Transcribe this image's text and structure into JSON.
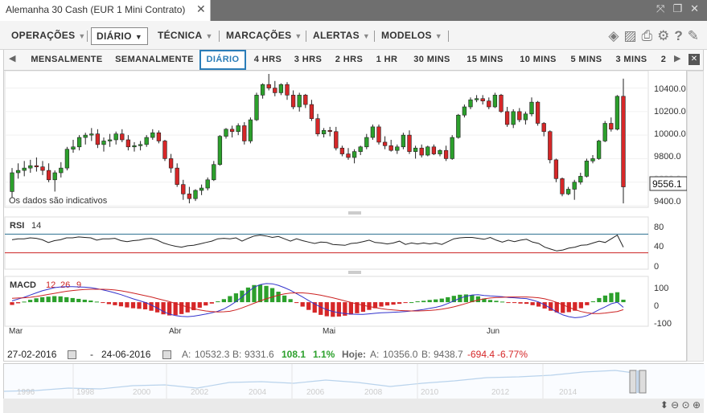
{
  "window": {
    "tab_title": "Alemanha 30 Cash (EUR 1 Mini Contrato)",
    "close_glyph": "✕",
    "icons": [
      "fit-icon",
      "restore-icon",
      "close-icon"
    ]
  },
  "menu": {
    "items": [
      {
        "label": "OPERAÇÕES",
        "active": false
      },
      {
        "label": "DIÁRIO",
        "active": true
      },
      {
        "label": "TÉCNICA",
        "active": false
      },
      {
        "label": "MARCAÇÕES",
        "active": false
      },
      {
        "label": "ALERTAS",
        "active": false
      },
      {
        "label": "MODELOS",
        "active": false
      }
    ],
    "tool_icons": [
      "layers-icon",
      "image-icon",
      "print-icon",
      "gear-icon",
      "help-icon",
      "pin-icon"
    ]
  },
  "timeframes": {
    "items": [
      "MENSALMENTE",
      "SEMANALMENTE",
      "DIÁRIO",
      "4 HRS",
      "3 HRS",
      "2 HRS",
      "1 HR",
      "30 MINS",
      "15 MINS",
      "10 MINS",
      "5 MINS",
      "3 MINS",
      "2"
    ],
    "active": "DIÁRIO"
  },
  "price_panel": {
    "note": "Os dados são indicativos",
    "y_ticks": [
      "10400.0",
      "10200.0",
      "10000.0",
      "9800.0",
      "9600.0",
      "9400.0"
    ],
    "current_price": "9556.1"
  },
  "rsi_panel": {
    "label": "RSI",
    "period": "14",
    "y_ticks": [
      "80",
      "40",
      "0"
    ]
  },
  "macd_panel": {
    "label": "MACD",
    "params": [
      "12",
      "26",
      "9"
    ],
    "y_ticks": [
      "100",
      "0",
      "-100"
    ]
  },
  "x_axis": {
    "months": [
      "Mar",
      "Abr",
      "Mai",
      "Jun"
    ]
  },
  "info": {
    "date_from": "27-02-2016",
    "dash": "-",
    "date_to": "24-06-2016",
    "a_label": "A:",
    "a_value": "10532.3",
    "b_label": "B:",
    "b_value": "9331.6",
    "change": "108.1",
    "change_pct": "1.1%",
    "today_label": "Hoje:",
    "today_a_label": "A:",
    "today_a": "10356.0",
    "today_b_label": "B:",
    "today_b": "9438.7",
    "today_change": "-694.4",
    "today_change_pct": "-6.77%"
  },
  "navigator": {
    "years": [
      "1996",
      "1998",
      "2000",
      "2002",
      "2004",
      "2006",
      "2008",
      "2010",
      "2012",
      "2014"
    ]
  },
  "colors": {
    "up": "#2ca02c",
    "down": "#d62728",
    "rsi_line": "#222222",
    "macd_line": "#3333cc",
    "signal_line": "#cc2222",
    "rsi_upper": "#2a6f8f",
    "rsi_lower": "#cc2222",
    "accent": "#2a7db8"
  },
  "chart_data": [
    {
      "type": "candlestick",
      "title": "",
      "ylim": [
        9400,
        10520
      ],
      "current": 9556.1,
      "candles": [
        [
          9520,
          9720,
          9470,
          9680
        ],
        [
          9680,
          9760,
          9630,
          9700
        ],
        [
          9700,
          9780,
          9650,
          9720
        ],
        [
          9720,
          9790,
          9680,
          9740
        ],
        [
          9740,
          9810,
          9690,
          9730
        ],
        [
          9730,
          9780,
          9660,
          9700
        ],
        [
          9700,
          9760,
          9600,
          9620
        ],
        [
          9620,
          9700,
          9520,
          9680
        ],
        [
          9680,
          9770,
          9640,
          9720
        ],
        [
          9720,
          9900,
          9700,
          9880
        ],
        [
          9880,
          9960,
          9850,
          9900
        ],
        [
          9900,
          10000,
          9870,
          9980
        ],
        [
          9980,
          10020,
          9920,
          10000
        ],
        [
          10000,
          10060,
          9950,
          10010
        ],
        [
          10010,
          10050,
          9890,
          9920
        ],
        [
          9920,
          9980,
          9860,
          9950
        ],
        [
          9950,
          10010,
          9900,
          9960
        ],
        [
          9960,
          10030,
          9920,
          10010
        ],
        [
          10010,
          10050,
          9940,
          9960
        ],
        [
          9960,
          10000,
          9870,
          9900
        ],
        [
          9900,
          9940,
          9860,
          9910
        ],
        [
          9910,
          9950,
          9870,
          9920
        ],
        [
          9920,
          10000,
          9900,
          9980
        ],
        [
          9980,
          10050,
          9960,
          10020
        ],
        [
          10020,
          10040,
          9930,
          9950
        ],
        [
          9950,
          9960,
          9780,
          9800
        ],
        [
          9800,
          9840,
          9680,
          9720
        ],
        [
          9720,
          9760,
          9560,
          9580
        ],
        [
          9580,
          9620,
          9450,
          9500
        ],
        [
          9500,
          9560,
          9420,
          9460
        ],
        [
          9460,
          9540,
          9440,
          9530
        ],
        [
          9530,
          9580,
          9490,
          9550
        ],
        [
          9550,
          9640,
          9530,
          9620
        ],
        [
          9620,
          9780,
          9610,
          9750
        ],
        [
          9750,
          10000,
          9740,
          9990
        ],
        [
          9990,
          10060,
          9970,
          10050
        ],
        [
          10050,
          10080,
          9980,
          10030
        ],
        [
          10030,
          10100,
          10000,
          10080
        ],
        [
          10080,
          10110,
          9920,
          9950
        ],
        [
          9950,
          10150,
          9930,
          10130
        ],
        [
          10130,
          10360,
          10120,
          10340
        ],
        [
          10340,
          10440,
          10310,
          10430
        ],
        [
          10430,
          10520,
          10380,
          10400
        ],
        [
          10400,
          10460,
          10330,
          10360
        ],
        [
          10360,
          10440,
          10340,
          10430
        ],
        [
          10430,
          10450,
          10300,
          10340
        ],
        [
          10340,
          10380,
          10220,
          10240
        ],
        [
          10240,
          10360,
          10200,
          10340
        ],
        [
          10340,
          10350,
          10230,
          10260
        ],
        [
          10260,
          10300,
          10120,
          10140
        ],
        [
          10140,
          10180,
          9990,
          10010
        ],
        [
          10010,
          10060,
          9980,
          10040
        ],
        [
          10040,
          10070,
          9990,
          10030
        ],
        [
          10030,
          10070,
          9870,
          9890
        ],
        [
          9890,
          9910,
          9820,
          9840
        ],
        [
          9840,
          9890,
          9790,
          9810
        ],
        [
          9810,
          9880,
          9760,
          9860
        ],
        [
          9860,
          9910,
          9830,
          9900
        ],
        [
          9900,
          10010,
          9880,
          9980
        ],
        [
          9980,
          10090,
          9960,
          10070
        ],
        [
          10070,
          10090,
          9920,
          9940
        ],
        [
          9940,
          9990,
          9880,
          9910
        ],
        [
          9910,
          9960,
          9860,
          9870
        ],
        [
          9870,
          9920,
          9840,
          9900
        ],
        [
          9900,
          10020,
          9880,
          10000
        ],
        [
          10000,
          10040,
          9840,
          9860
        ],
        [
          9860,
          9910,
          9800,
          9890
        ],
        [
          9890,
          9920,
          9810,
          9830
        ],
        [
          9830,
          9910,
          9820,
          9900
        ],
        [
          9900,
          9920,
          9830,
          9840
        ],
        [
          9840,
          9880,
          9820,
          9870
        ],
        [
          9870,
          9910,
          9780,
          9800
        ],
        [
          9800,
          10000,
          9790,
          9980
        ],
        [
          9980,
          10180,
          9970,
          10170
        ],
        [
          10170,
          10260,
          10150,
          10240
        ],
        [
          10240,
          10320,
          10220,
          10300
        ],
        [
          10300,
          10340,
          10280,
          10310
        ],
        [
          10310,
          10340,
          10260,
          10290
        ],
        [
          10290,
          10320,
          10220,
          10240
        ],
        [
          10240,
          10360,
          10230,
          10340
        ],
        [
          10340,
          10350,
          10190,
          10200
        ],
        [
          10200,
          10240,
          10070,
          10090
        ],
        [
          10090,
          10220,
          10060,
          10200
        ],
        [
          10200,
          10230,
          10110,
          10130
        ],
        [
          10130,
          10200,
          10090,
          10180
        ],
        [
          10180,
          10320,
          10160,
          10280
        ],
        [
          10280,
          10290,
          10080,
          10100
        ],
        [
          10100,
          10110,
          9990,
          10030
        ],
        [
          10030,
          10040,
          9760,
          9790
        ],
        [
          9790,
          9800,
          9600,
          9630
        ],
        [
          9630,
          9640,
          9480,
          9500
        ],
        [
          9500,
          9560,
          9490,
          9540
        ],
        [
          9540,
          9620,
          9450,
          9600
        ],
        [
          9600,
          9680,
          9580,
          9650
        ],
        [
          9650,
          9800,
          9640,
          9780
        ],
        [
          9780,
          9830,
          9760,
          9800
        ],
        [
          9800,
          9960,
          9790,
          9950
        ],
        [
          9950,
          10120,
          9940,
          10100
        ],
        [
          10100,
          10150,
          10030,
          10050
        ],
        [
          10050,
          10340,
          10040,
          10330
        ],
        [
          10330,
          10480,
          9420,
          9560
        ]
      ]
    },
    {
      "type": "line",
      "title": "",
      "ylim": [
        0,
        100
      ],
      "series": [
        {
          "name": "RSI 14",
          "values": [
            58,
            60,
            60,
            62,
            61,
            58,
            52,
            56,
            58,
            62,
            62,
            64,
            63,
            62,
            57,
            60,
            60,
            61,
            56,
            54,
            56,
            57,
            60,
            61,
            57,
            51,
            47,
            44,
            42,
            45,
            46,
            49,
            52,
            55,
            60,
            61,
            60,
            62,
            55,
            61,
            66,
            68,
            66,
            63,
            65,
            60,
            55,
            60,
            56,
            53,
            50,
            53,
            52,
            48,
            47,
            46,
            50,
            51,
            54,
            57,
            52,
            51,
            49,
            51,
            55,
            48,
            51,
            49,
            51,
            49,
            51,
            48,
            54,
            60,
            62,
            63,
            63,
            61,
            59,
            63,
            57,
            53,
            57,
            54,
            57,
            59,
            53,
            50,
            42,
            38,
            34,
            36,
            40,
            42,
            46,
            47,
            51,
            55,
            52,
            60,
            68,
            42
          ]
        }
      ],
      "reference_levels": [
        70,
        30
      ]
    },
    {
      "type": "bar",
      "title": "",
      "ylim": [
        -130,
        140
      ],
      "series": [
        {
          "name": "MACD",
          "values": [
            10,
            24,
            38,
            55,
            72,
            88,
            100,
            112,
            118,
            120,
            120,
            118,
            116,
            112,
            104,
            95,
            84,
            72,
            58,
            42,
            26,
            12,
            -2,
            -22,
            -46,
            -72,
            -92,
            -104,
            -110,
            -112,
            -108,
            -100,
            -92,
            -82,
            -70,
            -52,
            -26,
            4,
            40,
            80,
            116,
            136,
            144,
            142,
            130,
            112,
            92,
            66,
            40,
            12,
            -14,
            -38,
            -58,
            -72,
            -82,
            -88,
            -92,
            -94,
            -94,
            -90,
            -86,
            -82,
            -80,
            -78,
            -76,
            -72,
            -68,
            -62,
            -56,
            -48,
            -40,
            -28,
            -10,
            10,
            30,
            46,
            56,
            58,
            52,
            48,
            46,
            42,
            36,
            34,
            30,
            28,
            16,
            2,
            -20,
            -48,
            -76,
            -98,
            -112,
            -120,
            -116,
            -104,
            -82,
            -58,
            -36,
            -12,
            0,
            -40
          ]
        },
        {
          "name": "Signal",
          "values": [
            30,
            32,
            34,
            38,
            44,
            52,
            60,
            68,
            76,
            84,
            90,
            94,
            98,
            100,
            100,
            100,
            98,
            94,
            88,
            80,
            70,
            60,
            50,
            40,
            28,
            16,
            4,
            -10,
            -24,
            -38,
            -50,
            -60,
            -68,
            -72,
            -76,
            -74,
            -70,
            -60,
            -44,
            -26,
            -8,
            10,
            26,
            40,
            54,
            64,
            70,
            72,
            72,
            68,
            62,
            54,
            44,
            34,
            22,
            10,
            -2,
            -14,
            -24,
            -34,
            -42,
            -50,
            -56,
            -60,
            -64,
            -66,
            -68,
            -68,
            -66,
            -64,
            -60,
            -54,
            -46,
            -36,
            -24,
            -10,
            4,
            16,
            26,
            32,
            36,
            38,
            40,
            40,
            40,
            40,
            38,
            34,
            26,
            14,
            -2,
            -20,
            -40,
            -58,
            -72,
            -82,
            -88,
            -88,
            -84,
            -78,
            -72,
            -58
          ]
        }
      ]
    }
  ]
}
